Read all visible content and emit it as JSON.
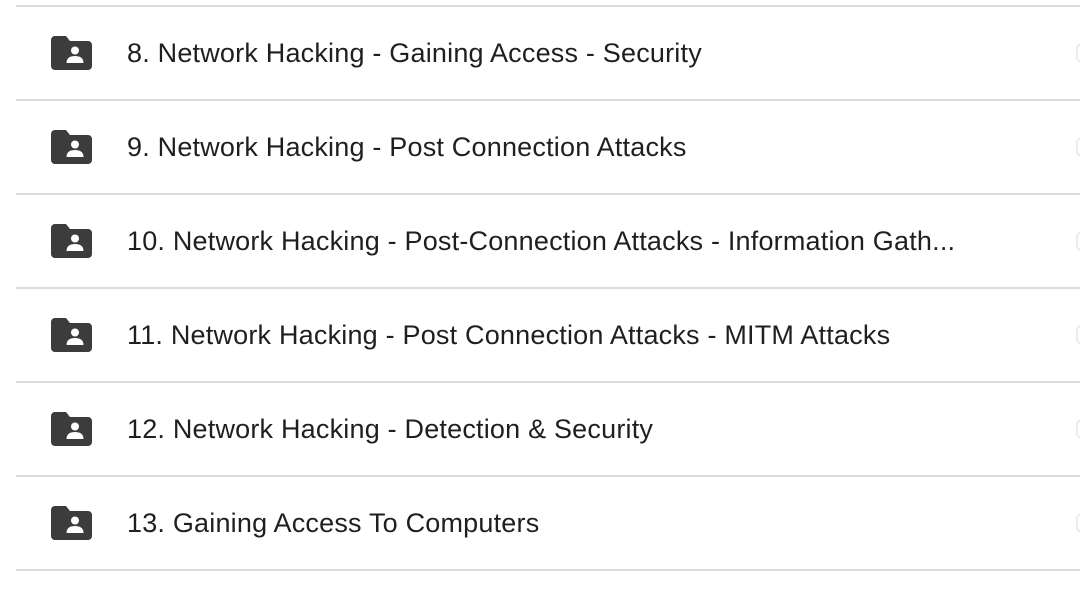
{
  "folder_list": {
    "items": [
      {
        "label": "8. Network Hacking - Gaining Access - Security",
        "icon": "shared-folder-icon"
      },
      {
        "label": "9. Network Hacking - Post Connection Attacks",
        "icon": "shared-folder-icon"
      },
      {
        "label": "10. Network Hacking - Post-Connection Attacks - Information Gath...",
        "icon": "shared-folder-icon"
      },
      {
        "label": "11. Network Hacking - Post Connection Attacks - MITM Attacks",
        "icon": "shared-folder-icon"
      },
      {
        "label": "12. Network Hacking - Detection & Security",
        "icon": "shared-folder-icon"
      },
      {
        "label": "13. Gaining Access To Computers",
        "icon": "shared-folder-icon"
      }
    ]
  },
  "colors": {
    "icon": "#3c3c3c",
    "text": "#1f1f1f",
    "divider": "#dcdcdc",
    "background": "#ffffff"
  }
}
